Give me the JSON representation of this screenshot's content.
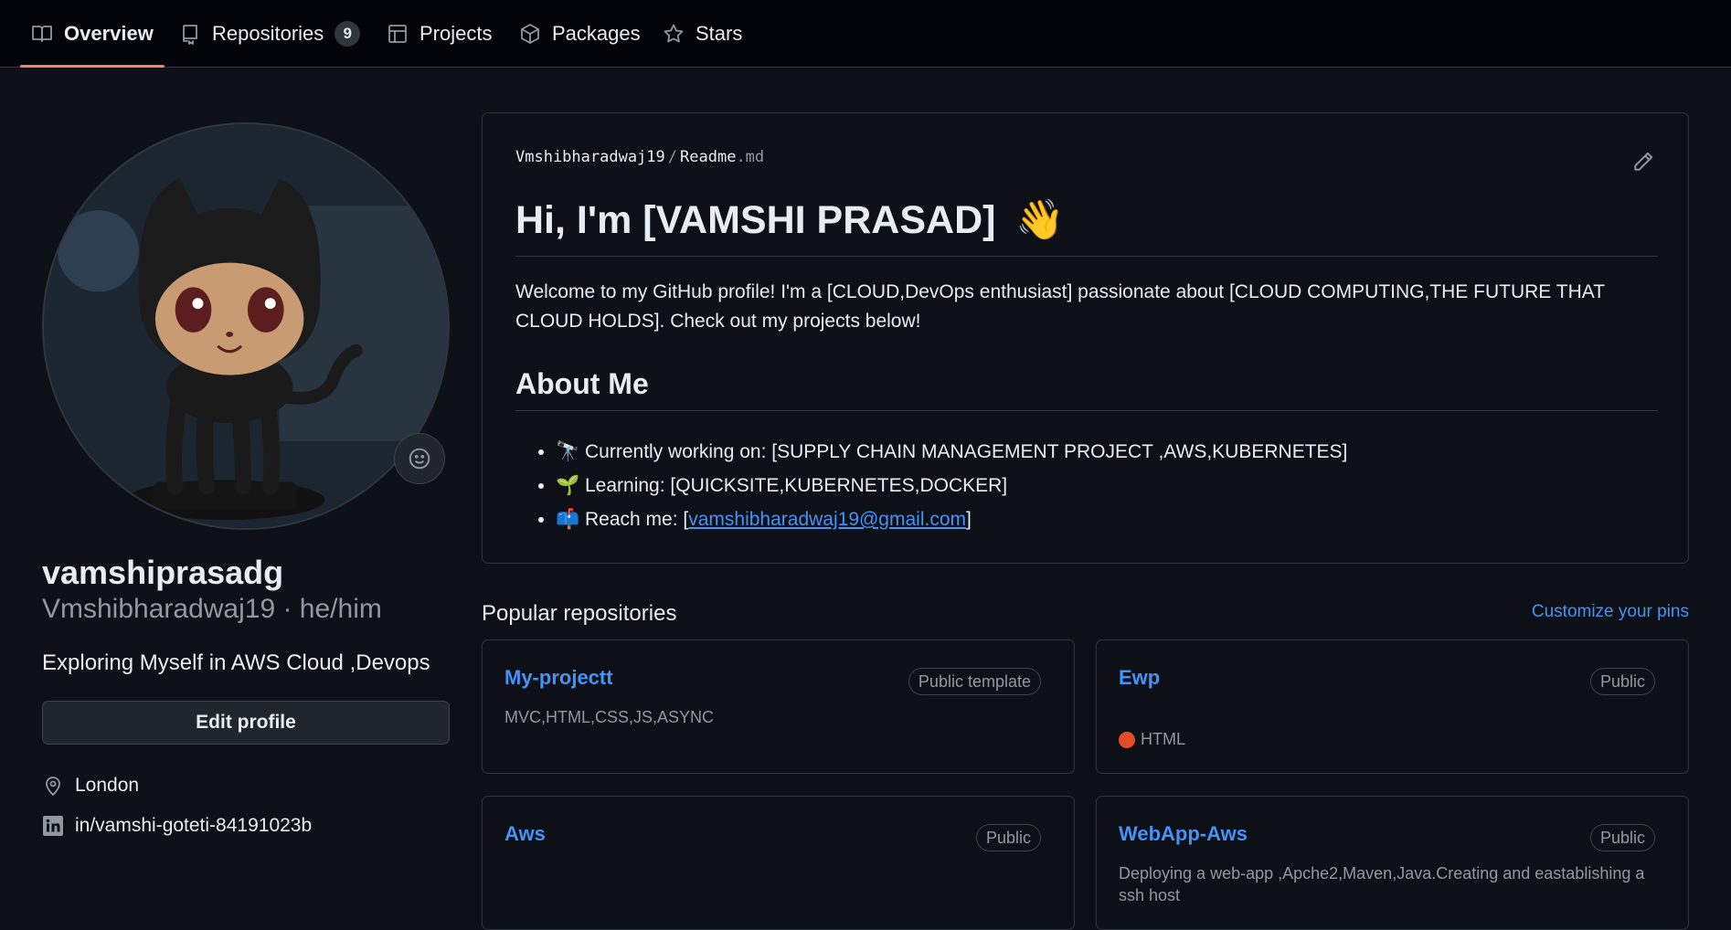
{
  "tabs": [
    {
      "label": "Overview",
      "icon": "book-icon",
      "active": true
    },
    {
      "label": "Repositories",
      "icon": "repo-icon",
      "count": "9"
    },
    {
      "label": "Projects",
      "icon": "table-icon"
    },
    {
      "label": "Packages",
      "icon": "package-icon"
    },
    {
      "label": "Stars",
      "icon": "star-icon"
    }
  ],
  "profile": {
    "fullname": "vamshiprasadg",
    "username_line": "Vmshibharadwaj19 · he/him",
    "bio": "Exploring Myself in AWS Cloud ,Devops",
    "edit_label": "Edit profile",
    "location": "London",
    "linkedin": "in/vamshi-goteti-84191023b"
  },
  "readme": {
    "path_user": "Vmshibharadwaj19",
    "path_sep": "/",
    "path_file": "Readme",
    "path_ext": ".md",
    "heading": "Hi, I'm [VAMSHI PRASAD]",
    "heading_emoji": "👋",
    "intro": "Welcome to my GitHub profile! I'm a [CLOUD,DevOps enthusiast] passionate about [CLOUD COMPUTING,THE FUTURE THAT CLOUD HOLDS]. Check out my projects below!",
    "about_heading": "About Me",
    "items": [
      {
        "emoji": "🔭",
        "text": "Currently working on: [SUPPLY CHAIN MANAGEMENT PROJECT ,AWS,KUBERNETES]"
      },
      {
        "emoji": "🌱",
        "text": "Learning: [QUICKSITE,KUBERNETES,DOCKER]"
      },
      {
        "emoji": "📫",
        "text_before": "Reach me: [",
        "link": "vamshibharadwaj19@gmail.com",
        "text_after": "]"
      }
    ]
  },
  "popular": {
    "title": "Popular repositories",
    "customize": "Customize your pins",
    "repos": [
      {
        "name": "My-projectt",
        "badge": "Public template",
        "description": "MVC,HTML,CSS,JS,ASYNC"
      },
      {
        "name": "Ewp",
        "badge": "Public",
        "language": "HTML",
        "language_color": "#e34c26"
      },
      {
        "name": "Aws",
        "badge": "Public"
      },
      {
        "name": "WebApp-Aws",
        "badge": "Public",
        "description": "Deploying a web-app ,Apche2,Maven,Java.Creating and eastablishing a ssh host"
      }
    ]
  },
  "colors": {
    "background": "#0d1117",
    "accent_link": "#4493f8",
    "tab_underline": "#f78166"
  }
}
